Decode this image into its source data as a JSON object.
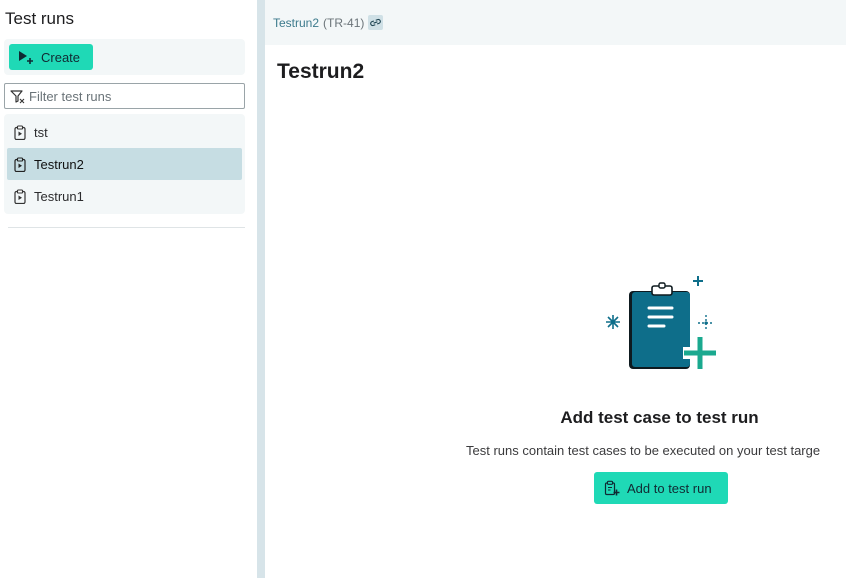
{
  "sidebar": {
    "title": "Test runs",
    "create_label": "Create",
    "filter_placeholder": "Filter test runs",
    "items": [
      {
        "label": "tst",
        "selected": false
      },
      {
        "label": "Testrun2",
        "selected": true
      },
      {
        "label": "Testrun1",
        "selected": false
      }
    ]
  },
  "breadcrumb": {
    "name": "Testrun2",
    "id": "(TR-41)"
  },
  "main": {
    "title": "Testrun2",
    "empty_title": "Add test case to test run",
    "empty_description": "Test runs contain test cases to be executed on your test targe",
    "add_button_label": "Add to test run"
  },
  "colors": {
    "accent": "#1fd9b6",
    "selected_row": "#c6dde3",
    "panel_bg": "#f3f7f8",
    "illustration_primary": "#0e6e8a",
    "illustration_plus": "#1aa98f"
  },
  "icons": {
    "create": "play-plus-icon",
    "filter": "filter-icon",
    "test_run": "clipboard-play-icon",
    "link": "link-icon",
    "add": "clipboard-plus-icon"
  }
}
